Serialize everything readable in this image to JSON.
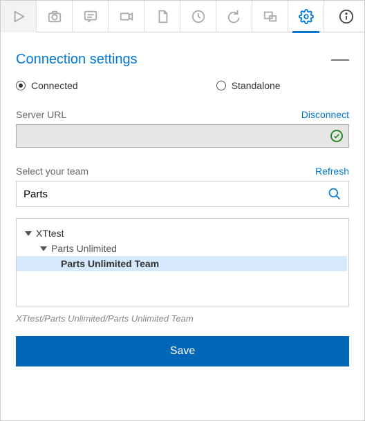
{
  "section": {
    "title": "Connection settings"
  },
  "mode": {
    "connected_label": "Connected",
    "standalone_label": "Standalone",
    "selected": "connected"
  },
  "server": {
    "label": "Server URL",
    "disconnect": "Disconnect",
    "value": "",
    "status": "valid"
  },
  "team": {
    "label": "Select your team",
    "refresh": "Refresh",
    "search_value": "Parts",
    "search_placeholder": ""
  },
  "tree": {
    "root": "XTtest",
    "project": "Parts Unlimited",
    "selected_team": "Parts Unlimited Team"
  },
  "path": "XTtest/Parts Unlimited/Parts Unlimited Team",
  "buttons": {
    "save": "Save"
  },
  "icons": {
    "play": "play-icon",
    "camera": "camera-icon",
    "comment": "comment-icon",
    "video": "video-icon",
    "document": "document-icon",
    "clock": "clock-icon",
    "retry": "retry-icon",
    "window": "window-icon",
    "settings": "settings-icon",
    "info": "info-icon",
    "check": "check-icon",
    "search": "search-icon",
    "collapse": "collapse-icon"
  },
  "colors": {
    "accent": "#0078d4",
    "save_bg": "#0067b8",
    "valid": "#2a8a2a",
    "selected_bg": "#d6e8fb"
  }
}
